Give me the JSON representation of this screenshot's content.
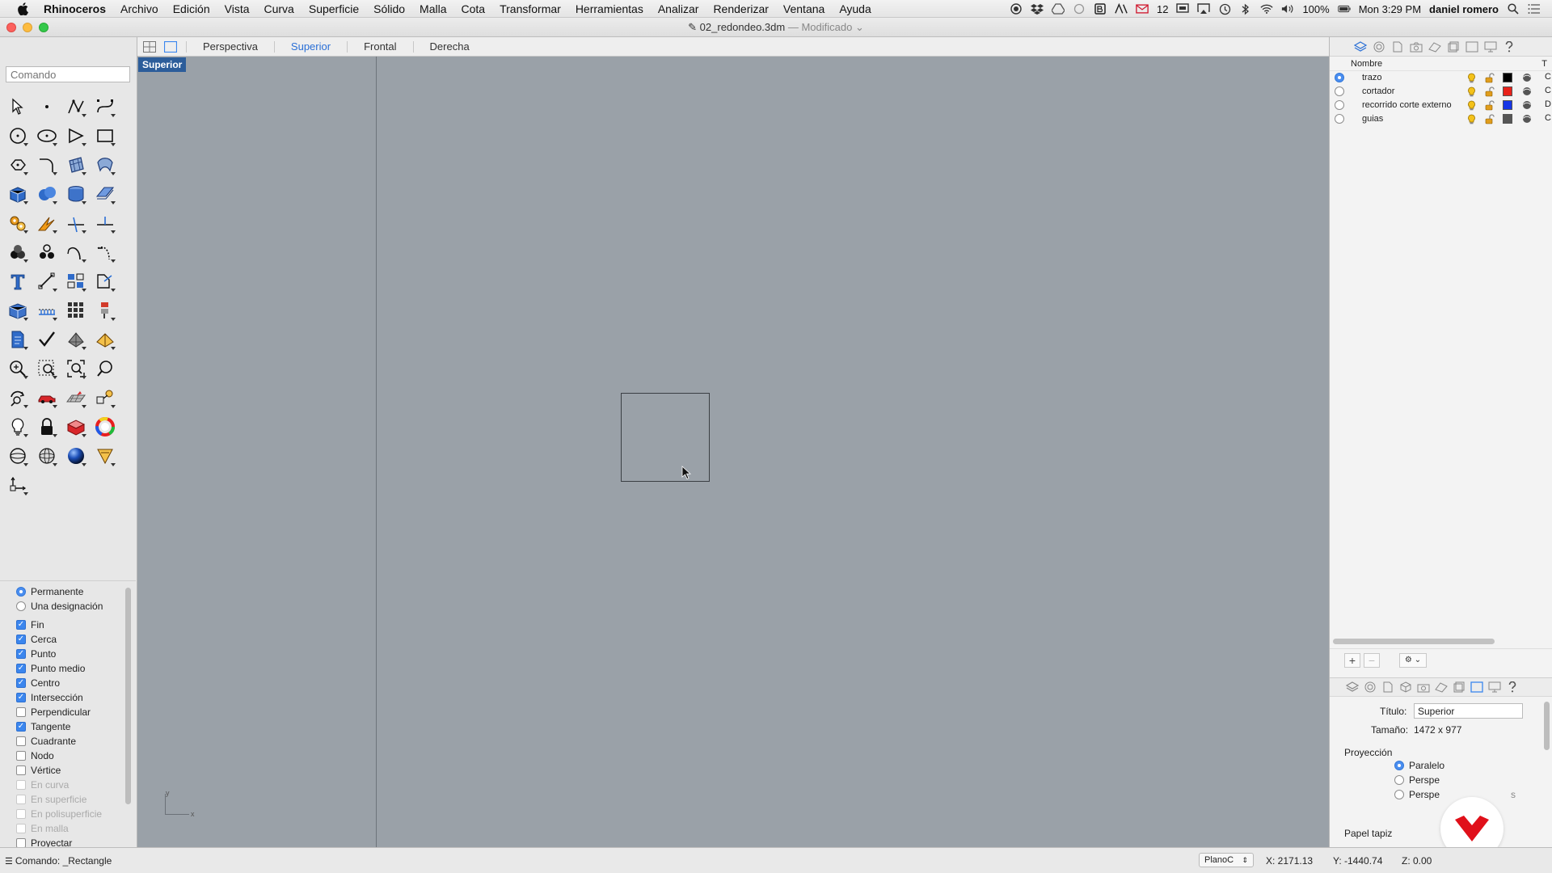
{
  "menubar": {
    "app": "Rhinoceros",
    "items": [
      "Archivo",
      "Edición",
      "Vista",
      "Curva",
      "Superficie",
      "Sólido",
      "Malla",
      "Cota",
      "Transformar",
      "Herramientas",
      "Analizar",
      "Renderizar",
      "Ventana",
      "Ayuda"
    ],
    "mail_count": "12",
    "battery": "100%",
    "clock": "Mon 3:29 PM",
    "user": "daniel romero"
  },
  "window": {
    "filename": "02_redondeo.3dm",
    "status": "— Modificado"
  },
  "command": {
    "placeholder": "Comando"
  },
  "viewport_tabs": [
    "Perspectiva",
    "Superior",
    "Frontal",
    "Derecha"
  ],
  "viewport_tabs_active": "Superior",
  "viewport": {
    "label": "Superior",
    "axis_y": "y",
    "axis_x": "x"
  },
  "osnap": {
    "modes": [
      {
        "label": "Permanente",
        "selected": true
      },
      {
        "label": "Una designación",
        "selected": false
      }
    ],
    "snaps": [
      {
        "label": "Fin",
        "checked": true,
        "enabled": true
      },
      {
        "label": "Cerca",
        "checked": true,
        "enabled": true
      },
      {
        "label": "Punto",
        "checked": true,
        "enabled": true
      },
      {
        "label": "Punto medio",
        "checked": true,
        "enabled": true
      },
      {
        "label": "Centro",
        "checked": true,
        "enabled": true
      },
      {
        "label": "Intersección",
        "checked": true,
        "enabled": true
      },
      {
        "label": "Perpendicular",
        "checked": false,
        "enabled": true
      },
      {
        "label": "Tangente",
        "checked": true,
        "enabled": true
      },
      {
        "label": "Cuadrante",
        "checked": false,
        "enabled": true
      },
      {
        "label": "Nodo",
        "checked": false,
        "enabled": true
      },
      {
        "label": "Vértice",
        "checked": false,
        "enabled": true
      },
      {
        "label": "En curva",
        "checked": false,
        "enabled": false
      },
      {
        "label": "En superficie",
        "checked": false,
        "enabled": false
      },
      {
        "label": "En polisuperficie",
        "checked": false,
        "enabled": false
      },
      {
        "label": "En malla",
        "checked": false,
        "enabled": false
      },
      {
        "label": "Proyectar",
        "checked": false,
        "enabled": true
      }
    ]
  },
  "layers": {
    "header_name": "Nombre",
    "header_extra": "T",
    "rows": [
      {
        "name": "trazo",
        "color": "#000000",
        "current": true,
        "extra": "C"
      },
      {
        "name": "cortador",
        "color": "#e8221a",
        "current": false,
        "extra": "C"
      },
      {
        "name": "recorrido corte externo",
        "color": "#1736e6",
        "current": false,
        "extra": "D"
      },
      {
        "name": "guias",
        "color": "#555555",
        "current": false,
        "extra": "C"
      }
    ]
  },
  "properties": {
    "title_label": "Título:",
    "title_value": "Superior",
    "size_label": "Tamaño:",
    "size_value": "1472 x 977",
    "projection_label": "Proyección",
    "projection_options": [
      "Paralelo",
      "Perspe",
      "Perspe"
    ],
    "projection_selected": 0,
    "projection_tail": "s",
    "wallpaper_label": "Papel tapiz"
  },
  "status": {
    "command_text": "Comando: _Rectangle",
    "cplane": "PlanoC",
    "x": "X: 2171.13",
    "y": "Y: -1440.74",
    "z": "Z: 0.00"
  },
  "colors": {
    "viewport_bg": "#9aa1a8",
    "accent": "#2a6fd6",
    "viewport_label_bg": "#2c5d9a",
    "logo_red": "#e0101a"
  }
}
